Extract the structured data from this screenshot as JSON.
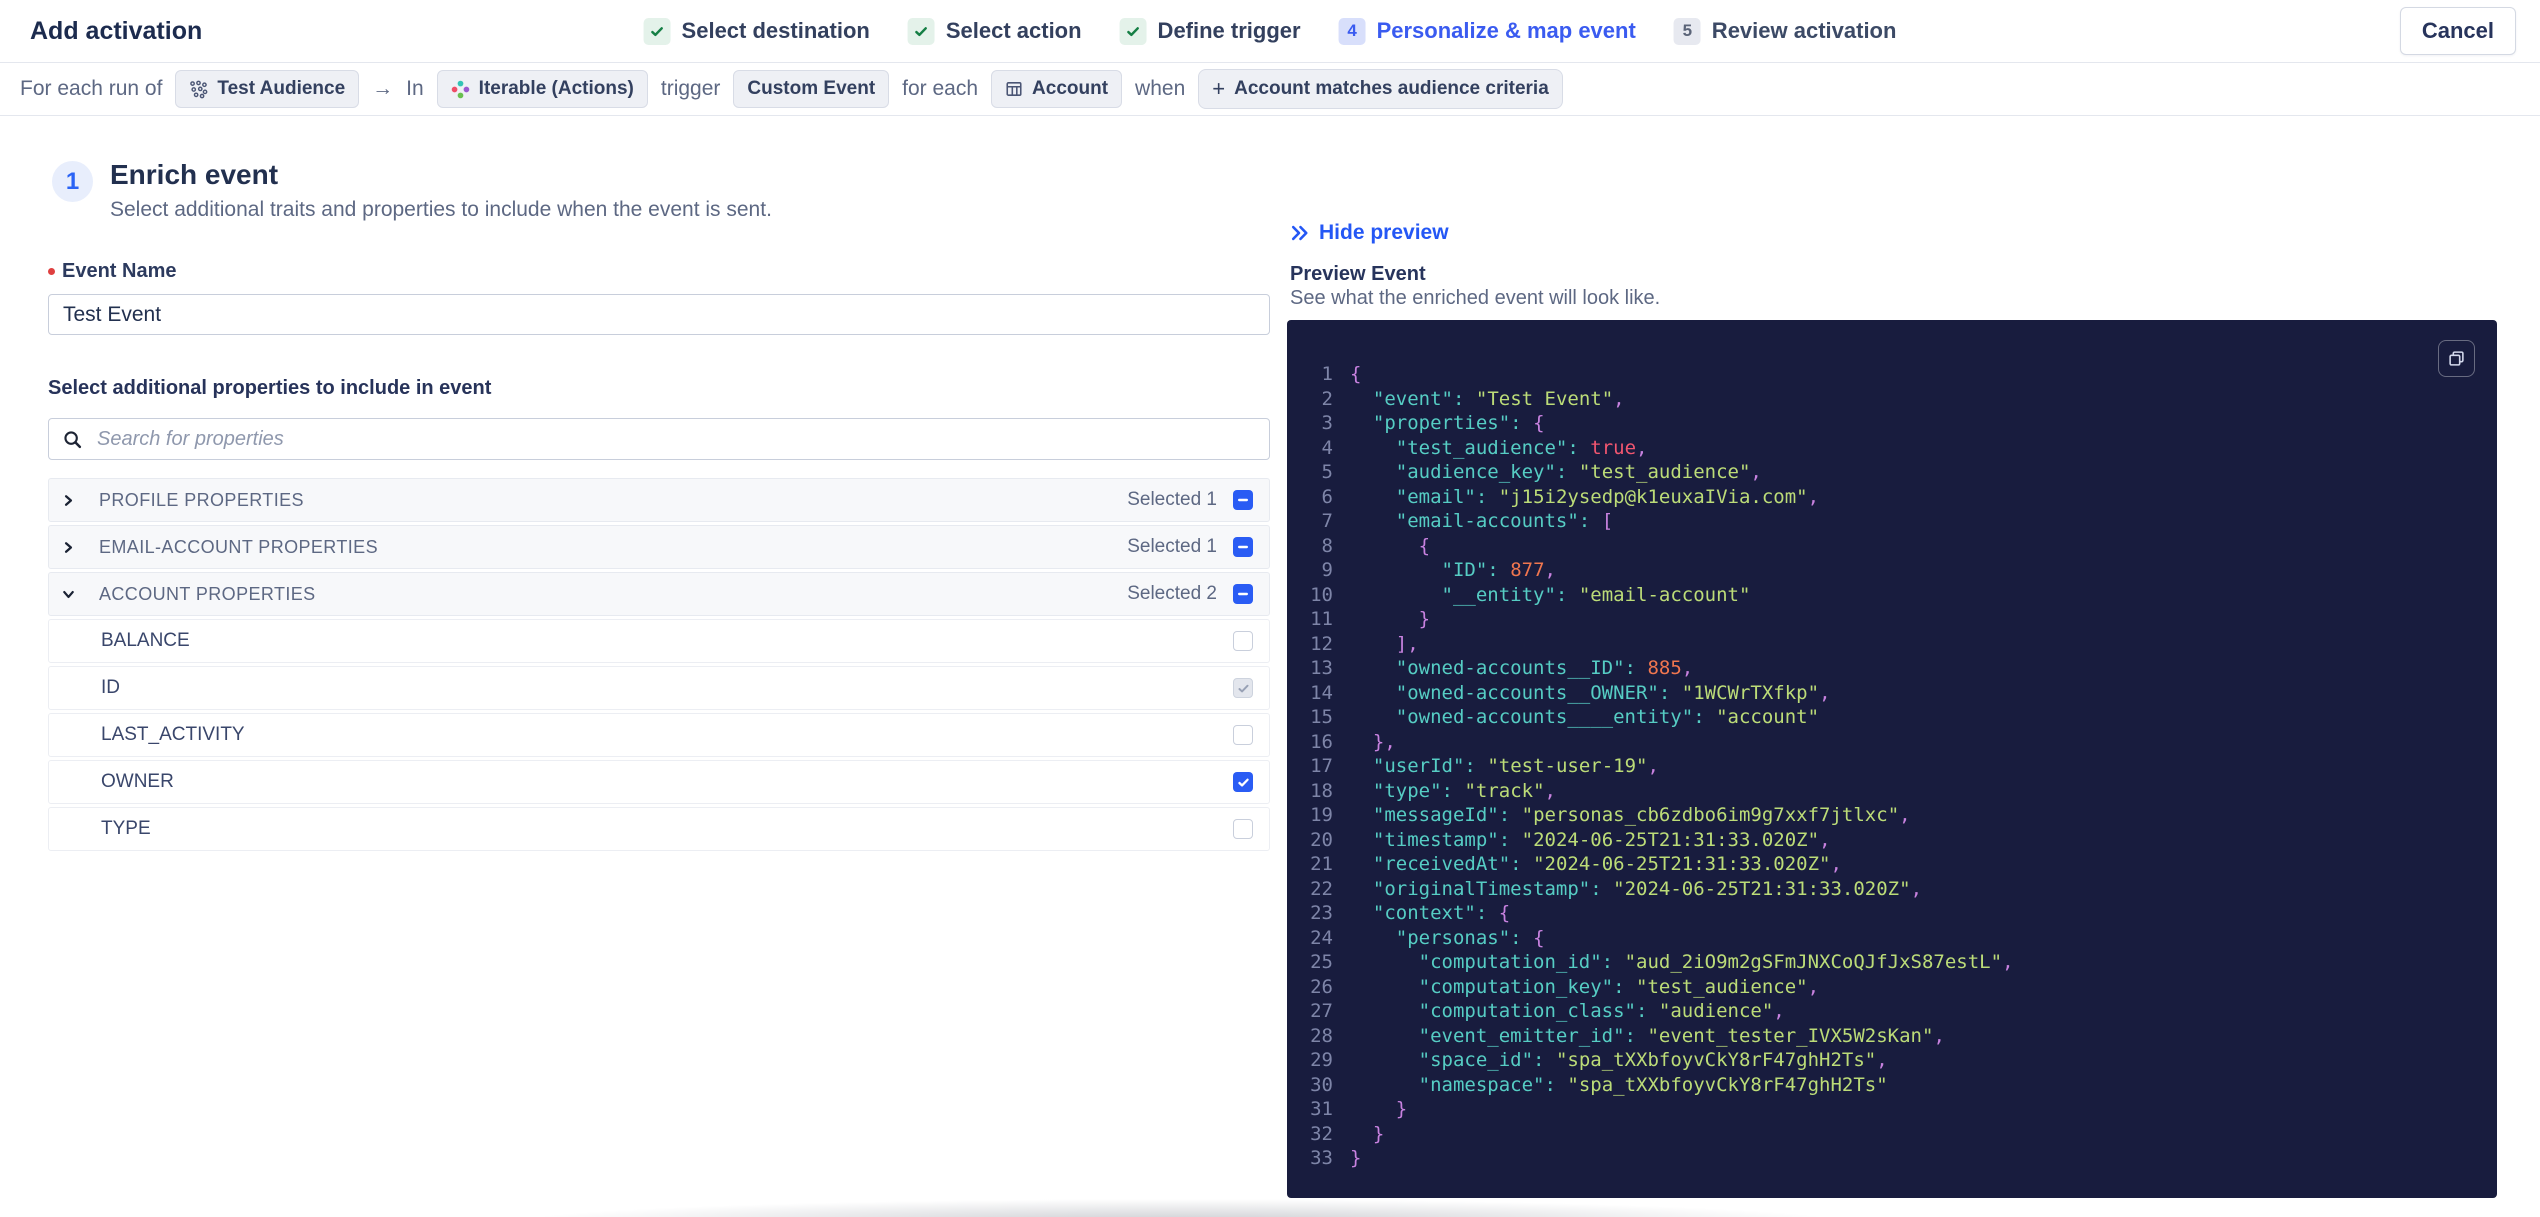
{
  "header": {
    "title": "Add activation",
    "cancel_label": "Cancel"
  },
  "stepper": [
    {
      "label": "Select destination",
      "state": "done"
    },
    {
      "label": "Select action",
      "state": "done"
    },
    {
      "label": "Define trigger",
      "state": "done"
    },
    {
      "label": "Personalize & map event",
      "state": "active",
      "number": "4"
    },
    {
      "label": "Review activation",
      "state": "upcoming",
      "number": "5"
    }
  ],
  "trigger_summary": {
    "parts": [
      {
        "type": "text",
        "value": "For each run of"
      },
      {
        "type": "chip",
        "value": "Test Audience",
        "icon": "audience-icon"
      },
      {
        "type": "arrow",
        "value": "→"
      },
      {
        "type": "text",
        "value": "In"
      },
      {
        "type": "chip",
        "value": "Iterable (Actions)",
        "icon": "iterable-icon"
      },
      {
        "type": "text",
        "value": "trigger"
      },
      {
        "type": "chip",
        "value": "Custom Event"
      },
      {
        "type": "text",
        "value": "for each"
      },
      {
        "type": "chip",
        "value": "Account",
        "icon": "account-table-icon"
      },
      {
        "type": "text",
        "value": "when"
      },
      {
        "type": "chip",
        "value": "Account matches audience criteria",
        "icon": "plus-icon",
        "large": true
      }
    ]
  },
  "step1": {
    "number": "1",
    "title": "Enrich event",
    "subtitle": "Select additional traits and properties to include when the event is sent."
  },
  "event_name": {
    "label": "Event Name",
    "required": true,
    "value": "Test Event"
  },
  "properties_section": {
    "label": "Select additional properties to include in event",
    "search_placeholder": "Search for properties"
  },
  "property_groups": [
    {
      "name": "PROFILE PROPERTIES",
      "selected_label": "Selected 1",
      "expanded": false
    },
    {
      "name": "EMAIL-ACCOUNT PROPERTIES",
      "selected_label": "Selected 1",
      "expanded": false
    },
    {
      "name": "ACCOUNT PROPERTIES",
      "selected_label": "Selected 2",
      "expanded": true,
      "children": [
        {
          "name": "BALANCE",
          "state": "unchecked"
        },
        {
          "name": "ID",
          "state": "checked_disabled"
        },
        {
          "name": "LAST_ACTIVITY",
          "state": "unchecked"
        },
        {
          "name": "OWNER",
          "state": "checked"
        },
        {
          "name": "TYPE",
          "state": "unchecked"
        }
      ]
    }
  ],
  "preview": {
    "hide_label": "Hide preview",
    "title": "Preview Event",
    "description": "See what the enriched event will look like.",
    "code_lines": [
      "{",
      "  \"event\": \"Test Event\",",
      "  \"properties\": {",
      "    \"test_audience\": true,",
      "    \"audience_key\": \"test_audience\",",
      "    \"email\": \"j15i2ysedp@k1euxaIVia.com\",",
      "    \"email-accounts\": [",
      "      {",
      "        \"ID\": 877,",
      "        \"__entity\": \"email-account\"",
      "      }",
      "    ],",
      "    \"owned-accounts__ID\": 885,",
      "    \"owned-accounts__OWNER\": \"1WCWrTXfkp\",",
      "    \"owned-accounts____entity\": \"account\"",
      "  },",
      "  \"userId\": \"test-user-19\",",
      "  \"type\": \"track\",",
      "  \"messageId\": \"personas_cb6zdbo6im9g7xxf7jtlxc\",",
      "  \"timestamp\": \"2024-06-25T21:31:33.020Z\",",
      "  \"receivedAt\": \"2024-06-25T21:31:33.020Z\",",
      "  \"originalTimestamp\": \"2024-06-25T21:31:33.020Z\",",
      "  \"context\": {",
      "    \"personas\": {",
      "      \"computation_id\": \"aud_2iO9m2gSFmJNXCoQJfJxS87estL\",",
      "      \"computation_key\": \"test_audience\",",
      "      \"computation_class\": \"audience\",",
      "      \"event_emitter_id\": \"event_tester_IVX5W2sKan\",",
      "      \"space_id\": \"spa_tXXbfoyvCkY8rF47ghH2Ts\",",
      "      \"namespace\": \"spa_tXXbfoyvCkY8rF47ghH2Ts\"",
      "    }",
      "  }",
      "}"
    ]
  },
  "icons": {
    "arrow_right": "→",
    "plus": "+",
    "double_chevron_right": "»",
    "step_check": "✓"
  },
  "colors": {
    "accent_blue": "#2a5cf4",
    "success_green": "#157f45",
    "code_background": "#181c3e",
    "code_key": "#56cdc4",
    "code_string": "#bcdc78",
    "code_number": "#f0764f",
    "code_boolean": "#f25670",
    "code_punctuation": "#c882e0",
    "iterable_teal": "#33c3b5",
    "iterable_pink": "#ef4d66",
    "iterable_purple": "#9b59d0",
    "iterable_green": "#69bf4f"
  }
}
